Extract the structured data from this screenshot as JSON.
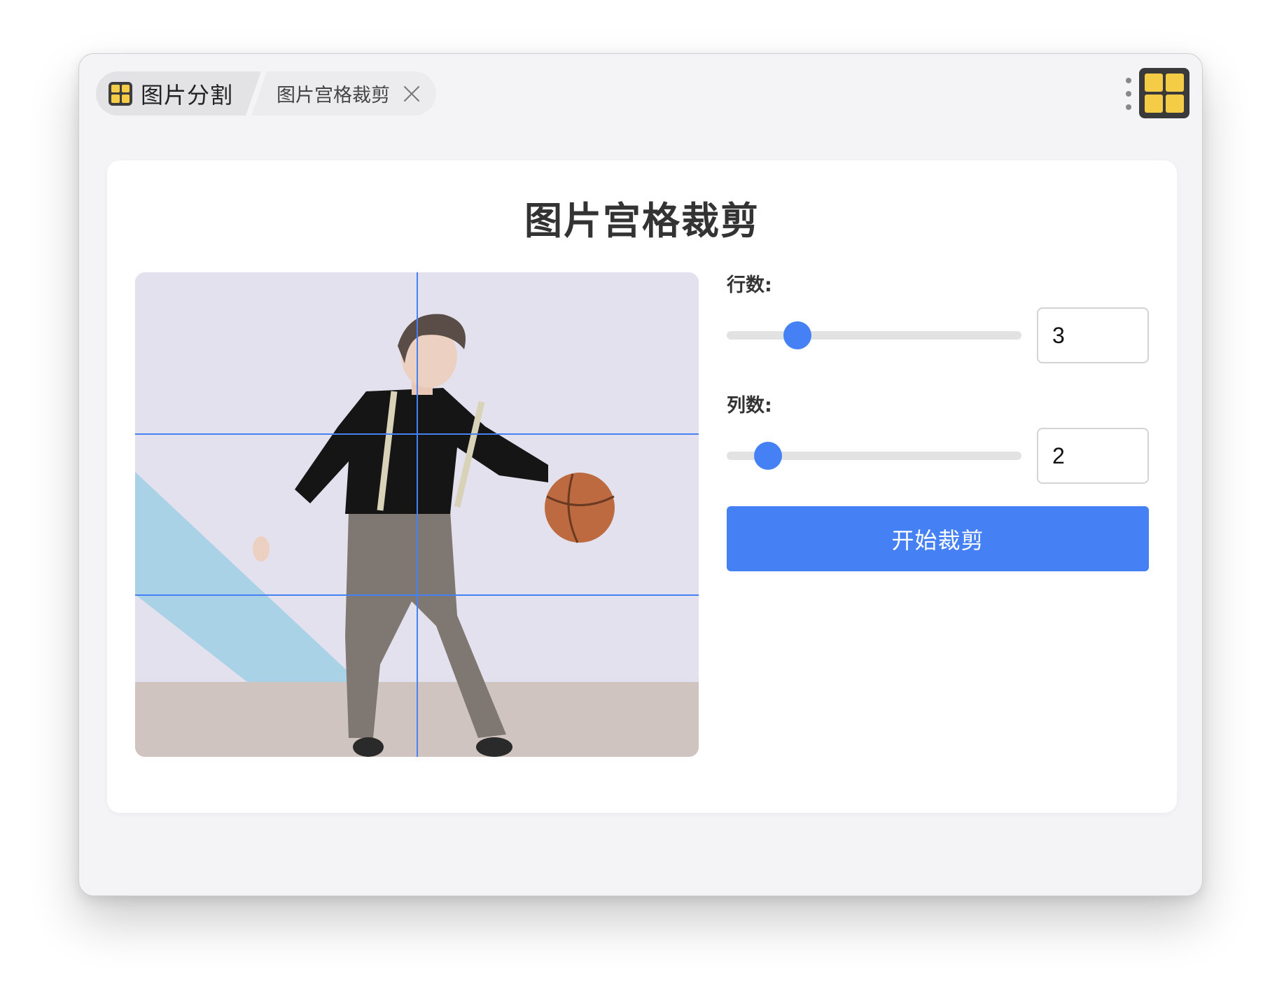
{
  "tabs": {
    "app_label": "图片分割",
    "page_label": "图片宫格裁剪"
  },
  "main": {
    "title": "图片宫格裁剪",
    "rows": {
      "label": "行数:",
      "value": "3",
      "slider_fraction": 0.24
    },
    "cols": {
      "label": "列数:",
      "value": "2",
      "slider_fraction": 0.14
    },
    "start_button_label": "开始裁剪"
  },
  "colors": {
    "accent": "#4580f5",
    "app_icon": "#f5cc45",
    "grid_line": "#4580f5"
  }
}
